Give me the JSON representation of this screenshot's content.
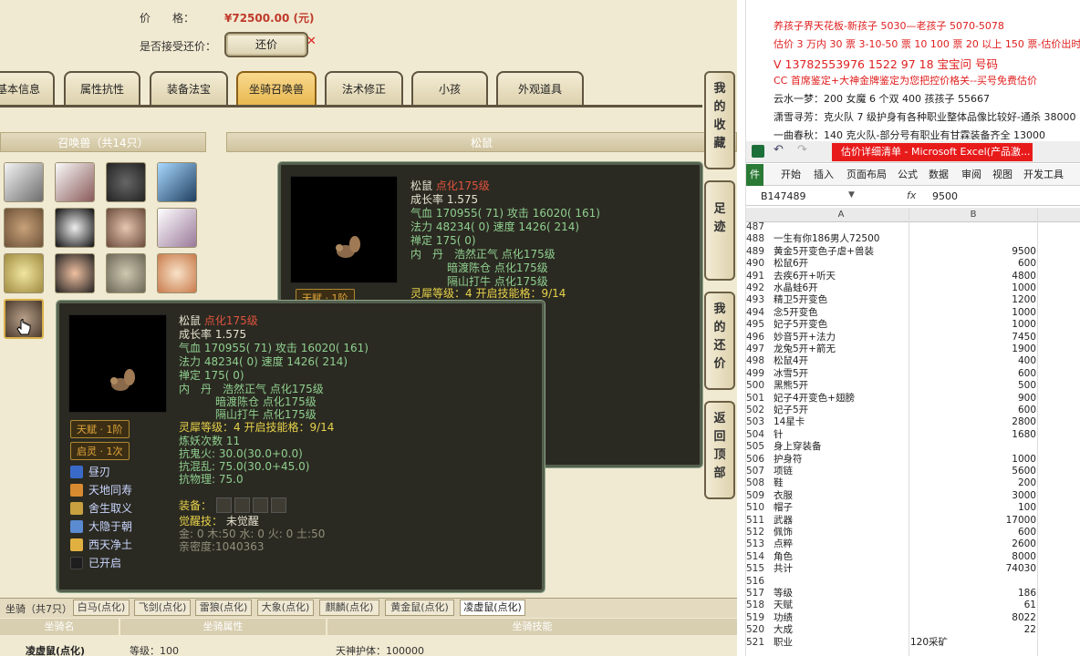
{
  "header": {
    "price_label": "价　　格：",
    "price_value": "¥72500.00 (元)",
    "bargain_label": "是否接受还价：",
    "bargain_button": "还价"
  },
  "tabs": [
    {
      "label": "基本信息"
    },
    {
      "label": "属性抗性"
    },
    {
      "label": "装备法宝"
    },
    {
      "label": "坐骑召唤兽"
    },
    {
      "label": "法术修正"
    },
    {
      "label": "小孩"
    },
    {
      "label": "外观道具"
    }
  ],
  "summon_header": "召唤兽（共14只）",
  "detail_header": "松鼠",
  "side_buttons": [
    {
      "label": "我的收藏"
    },
    {
      "label": "足迹"
    },
    {
      "label": "我的还价"
    },
    {
      "label": "返回顶部"
    }
  ],
  "pet_card": {
    "name": "松鼠",
    "level": "点化175级",
    "growth": "成长率 1.575",
    "hp": "气血 170955( 71) 攻击 16020( 161)",
    "mp": "法力 48234( 0) 速度 1426( 214)",
    "zen": "禅定 175( 0)",
    "neidan_label": "内　丹",
    "neidan": [
      "浩然正气 点化175级",
      "暗渡陈仓 点化175级",
      "隔山打牛 点化175级"
    ],
    "lingxi": "灵犀等级：4 开启技能格：9/14",
    "lianyao": "炼妖次数 11",
    "res1": "抗鬼火: 30.0(30.0+0.0)",
    "res2": "抗混乱: 75.0(30.0+45.0)",
    "res3": "抗物理: 75.0",
    "equip_label": "装备：",
    "awaken_label": "觉醒技：",
    "awaken_value": "未觉醒",
    "elements": "金: 0 木:50 水: 0 火: 0 土:50",
    "intimacy": "亲密度:1040363",
    "talent": "天赋 · 1阶",
    "enlight": "启灵 · 1次",
    "skills": [
      "昼刃",
      "天地同寿",
      "舍生取义",
      "大隐于朝",
      "西天净土",
      "已开启"
    ]
  },
  "mount_bar": {
    "title": "坐骑（共7只）",
    "tabs": [
      "白马(点化)",
      "飞剑(点化)",
      "雷狼(点化)",
      "大象(点化)",
      "麒麟(点化)",
      "黄金鼠(点化)",
      "凌虚鼠(点化)"
    ],
    "col1": "坐骑名",
    "col2": "坐骑属性",
    "col3": "坐骑技能",
    "row_name": "凌虚鼠(点化)",
    "row_level": "等级：100",
    "row_skill": "天神护体：100000"
  },
  "notes": [
    {
      "text": "养孩子界天花板-新孩子 5030—老孩子 5070-5078",
      "color": "#e02020"
    },
    {
      "text": "估价 3 万内 30 票 3-10-50 票 10 100 票 20 以上 150 票-估价出时",
      "color": "#e02020"
    },
    {
      "text": "V 13782553976    1522 97 18 宝宝问 号码",
      "color": "#e02020"
    },
    {
      "text": "CC 首席鉴定+大神金牌鉴定为您把控价格关--买号免费估价",
      "color": "#e02020"
    },
    {
      "text": "云水一梦：200 女魔 6 个双 400 孩孩子 55667",
      "color": "#222"
    },
    {
      "text": "潇雪寻芳：克火队 7 级护身有各种职业整体品像比较好-通杀 38000",
      "color": "#222"
    },
    {
      "text": "一曲春秋：140 克火队-部分号有职业有甘霖装备齐全 13000",
      "color": "#222"
    }
  ],
  "excel": {
    "title": "估价详细清单 - Microsoft Excel(产品激...",
    "menu": [
      "件",
      "开始",
      "插入",
      "页面布局",
      "公式",
      "数据",
      "审阅",
      "视图",
      "开发工具"
    ],
    "name_box": "B147489",
    "formula": "9500",
    "fx": "fx",
    "col_a": "A",
    "col_b": "B",
    "rows": [
      {
        "n": "487",
        "a": "",
        "b": ""
      },
      {
        "n": "488",
        "a": "一生有你186男人72500",
        "b": ""
      },
      {
        "n": "489",
        "a": "黄金5开变色子虐+兽装",
        "b": "9500"
      },
      {
        "n": "490",
        "a": "松鼠6开",
        "b": "600"
      },
      {
        "n": "491",
        "a": "去疾6开+听天",
        "b": "4800"
      },
      {
        "n": "492",
        "a": "水晶蛙6开",
        "b": "1000"
      },
      {
        "n": "493",
        "a": "精卫5开变色",
        "b": "1200"
      },
      {
        "n": "494",
        "a": "念5开变色",
        "b": "1000"
      },
      {
        "n": "495",
        "a": "妃子5开变色",
        "b": "1000"
      },
      {
        "n": "496",
        "a": "妙音5开+法力",
        "b": "7450"
      },
      {
        "n": "497",
        "a": "龙兔5开+箭无",
        "b": "1900"
      },
      {
        "n": "498",
        "a": "松鼠4开",
        "b": "400"
      },
      {
        "n": "499",
        "a": "冰雪5开",
        "b": "600"
      },
      {
        "n": "500",
        "a": "黑熊5开",
        "b": "500"
      },
      {
        "n": "501",
        "a": "妃子4开变色+翅膀",
        "b": "900"
      },
      {
        "n": "502",
        "a": "妃子5开",
        "b": "600"
      },
      {
        "n": "503",
        "a": "14星卡",
        "b": "2800"
      },
      {
        "n": "504",
        "a": "针",
        "b": "1680"
      },
      {
        "n": "505",
        "a": "身上穿装备",
        "b": ""
      },
      {
        "n": "506",
        "a": "护身符",
        "b": "1000"
      },
      {
        "n": "507",
        "a": "项链",
        "b": "5600"
      },
      {
        "n": "508",
        "a": "鞋",
        "b": "200"
      },
      {
        "n": "509",
        "a": "衣服",
        "b": "3000"
      },
      {
        "n": "510",
        "a": "帽子",
        "b": "100"
      },
      {
        "n": "511",
        "a": "武器",
        "b": "17000"
      },
      {
        "n": "512",
        "a": "佩饰",
        "b": "600"
      },
      {
        "n": "513",
        "a": "点粹",
        "b": "2600"
      },
      {
        "n": "514",
        "a": "角色",
        "b": "8000"
      },
      {
        "n": "515",
        "a": "共计",
        "b": "74030"
      },
      {
        "n": "516",
        "a": "",
        "b": ""
      },
      {
        "n": "517",
        "a": "等级",
        "b": "186"
      },
      {
        "n": "518",
        "a": "天赋",
        "b": "61"
      },
      {
        "n": "519",
        "a": "功绩",
        "b": "8022"
      },
      {
        "n": "520",
        "a": "大成",
        "b": "22"
      },
      {
        "n": "521",
        "a": "职业",
        "b": "120采矿"
      }
    ]
  }
}
